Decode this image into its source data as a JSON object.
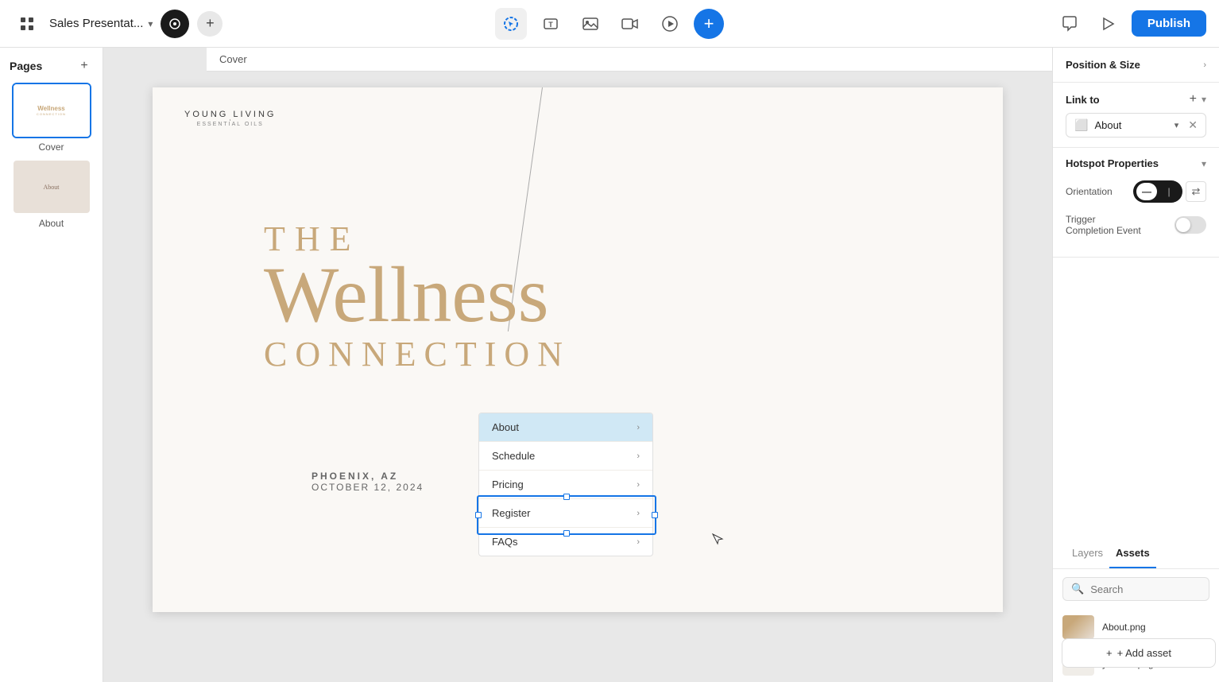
{
  "app": {
    "title": "Sales Presentat...",
    "publish_label": "Publish"
  },
  "topbar": {
    "project_name": "Sales Presentat...",
    "tools": [
      {
        "name": "cursor-tool",
        "label": "Cursor"
      },
      {
        "name": "text-tool",
        "label": "Text"
      },
      {
        "name": "image-tool",
        "label": "Image"
      },
      {
        "name": "video-tool",
        "label": "Video"
      },
      {
        "name": "play-tool",
        "label": "Play"
      },
      {
        "name": "add-tool",
        "label": "Add"
      }
    ]
  },
  "breadcrumb": {
    "label": "Cover"
  },
  "pages": {
    "title": "Pages",
    "add_label": "+",
    "items": [
      {
        "id": "cover",
        "label": "Cover",
        "selected": true
      },
      {
        "id": "about",
        "label": "About",
        "selected": false
      }
    ]
  },
  "slide": {
    "logo_name": "YOUNG LIVING",
    "logo_subtitle": "ESSENTIAL OILS",
    "headline_the": "THE",
    "headline_wellness": "Wellness",
    "headline_connection": "CONNECTION",
    "location": "PHOENIX, AZ",
    "date": "OCTOBER 12, 2024",
    "menu_items": [
      {
        "label": "About",
        "highlighted": true
      },
      {
        "label": "Schedule",
        "highlighted": false
      },
      {
        "label": "Pricing",
        "highlighted": false
      },
      {
        "label": "Register",
        "highlighted": false
      },
      {
        "label": "FAQs",
        "highlighted": false
      }
    ]
  },
  "right_panel": {
    "position_size_label": "Position & Size",
    "link_to_label": "Link to",
    "link_to_value": "About",
    "hotspot_properties_label": "Hotspot Properties",
    "orientation_label": "Orientation",
    "trigger_label": "Trigger",
    "completion_label": "Completion Event"
  },
  "assets": {
    "layers_tab": "Layers",
    "assets_tab": "Assets",
    "search_placeholder": "Search",
    "items": [
      {
        "name": "About.png",
        "type": "image"
      },
      {
        "name": "yl-cover.png",
        "type": "image-light"
      }
    ],
    "add_asset_label": "+ Add asset"
  }
}
